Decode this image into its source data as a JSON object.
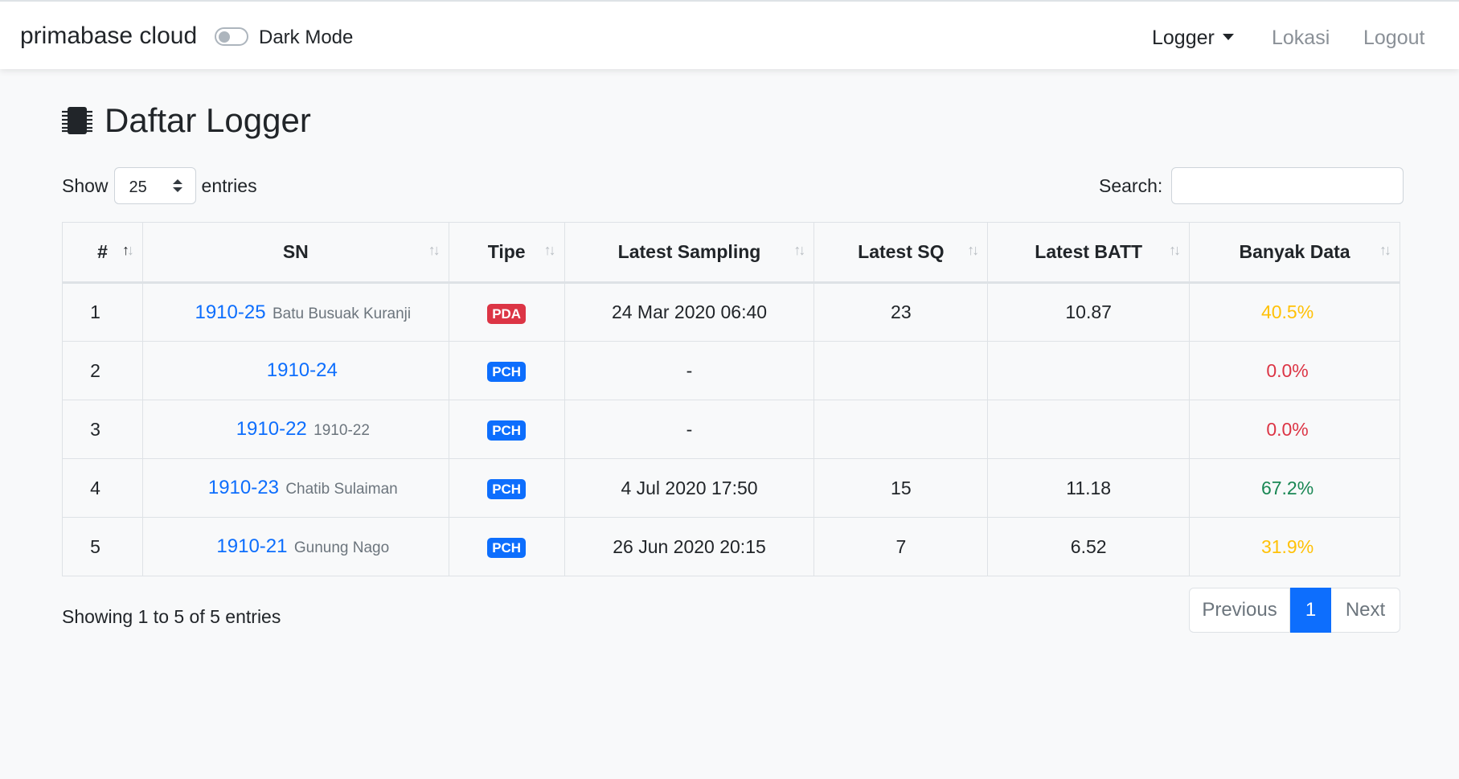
{
  "navbar": {
    "brand": "primabase cloud",
    "dark_mode_label": "Dark Mode",
    "items": [
      {
        "label": "Logger"
      },
      {
        "label": "Lokasi"
      },
      {
        "label": "Logout"
      }
    ]
  },
  "page": {
    "title": "Daftar Logger",
    "title_icon": "chip-icon"
  },
  "length_control": {
    "prefix": "Show",
    "selected": "25",
    "suffix": "entries"
  },
  "search": {
    "label": "Search:",
    "value": ""
  },
  "table": {
    "columns": [
      "#",
      "SN",
      "Tipe",
      "Latest Sampling",
      "Latest SQ",
      "Latest BATT",
      "Banyak Data"
    ],
    "rows": [
      {
        "no": "1",
        "sn": "1910-25",
        "loc": "Batu Busuak Kuranji",
        "tipe": "PDA",
        "tipe_color": "#dc3545",
        "sampling": "24 Mar 2020 06:40",
        "sq": "23",
        "batt": "10.87",
        "pct": "40.5%",
        "pct_color": "#ffc107"
      },
      {
        "no": "2",
        "sn": "1910-24",
        "loc": "",
        "tipe": "PCH",
        "tipe_color": "#0d6efd",
        "sampling": "-",
        "sq": "",
        "batt": "",
        "pct": "0.0%",
        "pct_color": "#dc3545"
      },
      {
        "no": "3",
        "sn": "1910-22",
        "loc": "1910-22",
        "tipe": "PCH",
        "tipe_color": "#0d6efd",
        "sampling": "-",
        "sq": "",
        "batt": "",
        "pct": "0.0%",
        "pct_color": "#dc3545"
      },
      {
        "no": "4",
        "sn": "1910-23",
        "loc": "Chatib Sulaiman",
        "tipe": "PCH",
        "tipe_color": "#0d6efd",
        "sampling": "4 Jul 2020 17:50",
        "sq": "15",
        "batt": "11.18",
        "pct": "67.2%",
        "pct_color": "#198754"
      },
      {
        "no": "5",
        "sn": "1910-21",
        "loc": "Gunung Nago",
        "tipe": "PCH",
        "tipe_color": "#0d6efd",
        "sampling": "26 Jun 2020 20:15",
        "sq": "7",
        "batt": "6.52",
        "pct": "31.9%",
        "pct_color": "#ffc107"
      }
    ]
  },
  "footer": {
    "info": "Showing 1 to 5 of 5 entries",
    "pagination": {
      "previous": "Previous",
      "current": "1",
      "next": "Next"
    }
  }
}
